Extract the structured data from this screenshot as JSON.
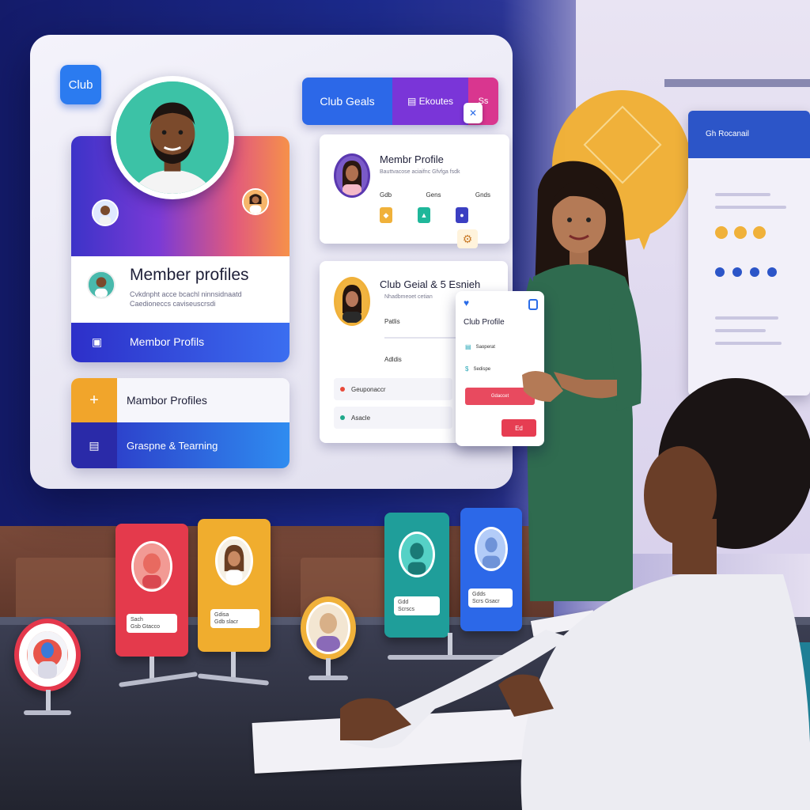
{
  "screen": {
    "club_badge": "Club",
    "hero": {
      "title": "Member profiles",
      "subtitle": "Cvkdnpht acce bcachl ninnsidnaatd Caedioneccs caviseuscrsdi",
      "bar_label": "Membor Profils",
      "bar_icon": "▣"
    },
    "list": {
      "row1_label": "Mambor Profiles",
      "row1_icon": "+",
      "row2_label": "Graspne & Tearning",
      "row2_icon": "▤"
    },
    "tabs": [
      {
        "label": "Club Geals"
      },
      {
        "label": "▤  Ekoutes"
      },
      {
        "label": "Ss"
      }
    ],
    "member_profile_card": {
      "title": "Membr Profile",
      "subtitle": "Bauttvacose aciaifnc Gfvfga fsdk",
      "labels": [
        "Gdb",
        "Gens",
        "Gnds"
      ],
      "close_icon": "✕"
    },
    "club_goals_card": {
      "title": "Club Geial & 5 Esnieh",
      "subtitle": "Nhadbmeoet cetian",
      "label1": "Patlis",
      "label2": "Adldis",
      "items": [
        "Geuponaccr",
        "Asacle"
      ],
      "gear_icon": "⚙"
    },
    "club_profile_card": {
      "title": "Club Profile",
      "rows": [
        "Saoperat",
        "Sedispe"
      ],
      "button1": "Gdaccet",
      "button2": "Ed"
    }
  },
  "board": {
    "header": "Gh Rocanail"
  },
  "standees": [
    {
      "tag1": "Sach",
      "tag2": "Gsb Gtacco"
    },
    {
      "tag1": "Gdisa",
      "tag2": "Gdb slacr"
    },
    {
      "tag1": "Gdd",
      "tag2": "Scrscs"
    },
    {
      "tag1": "Gdds",
      "tag2": "Scrs Gsacr"
    }
  ],
  "colors": {
    "primary_blue": "#2c68e8",
    "purple": "#7a35d8",
    "pink": "#d9368f",
    "accent_orange": "#f1a52b",
    "danger_red": "#e63d52",
    "teal": "#1f9e9a"
  }
}
